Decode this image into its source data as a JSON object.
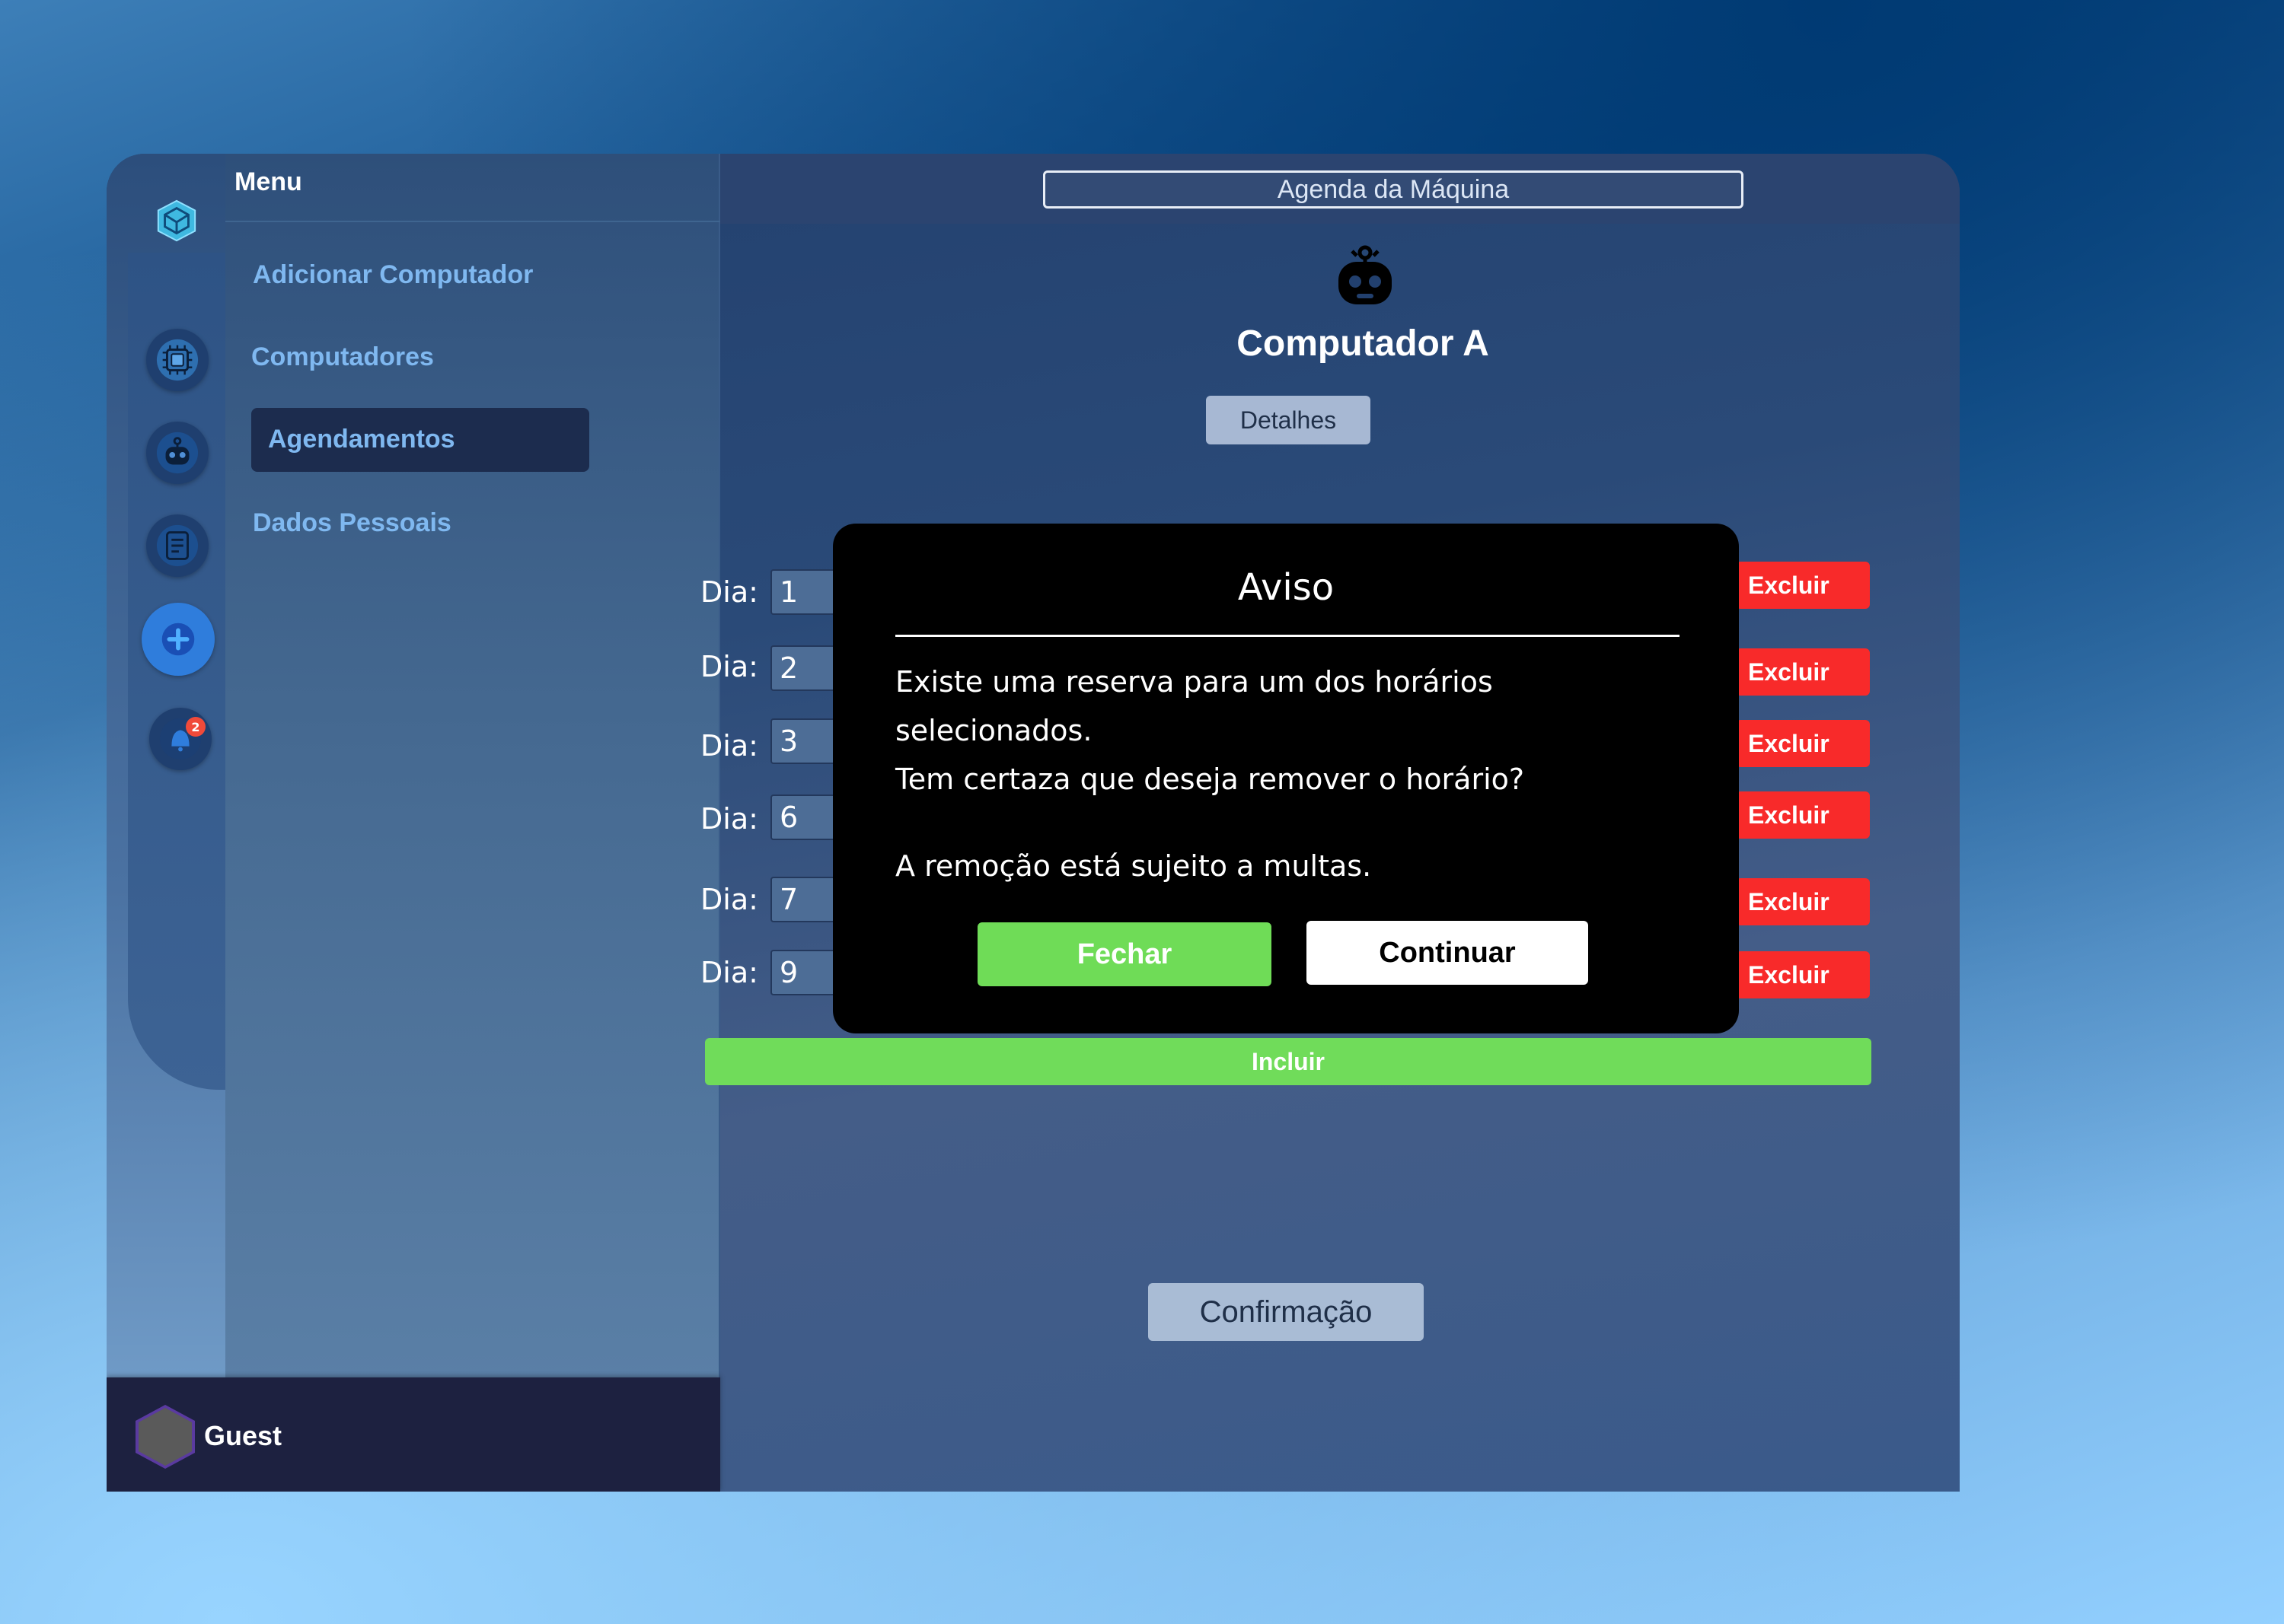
{
  "menu": {
    "title": "Menu",
    "items": [
      {
        "label": "Adicionar Computador"
      },
      {
        "label": "Computadores"
      },
      {
        "label": "Agendamentos",
        "active": true
      },
      {
        "label": "Dados Pessoais"
      }
    ]
  },
  "rail": {
    "icons": [
      "logo-icon",
      "computer-chip-icon",
      "robot-icon",
      "list-icon",
      "add-icon",
      "bell-icon"
    ],
    "notification_count": "2"
  },
  "user": {
    "name": "Guest"
  },
  "header": {
    "title": "Agenda da Máquina"
  },
  "machine": {
    "name": "Computador A",
    "details_label": "Detalhes"
  },
  "schedule": {
    "day_label": "Dia:",
    "rows": [
      {
        "day": "1",
        "delete_label": "Excluir"
      },
      {
        "day": "2",
        "delete_label": "Excluir"
      },
      {
        "day": "3",
        "delete_label": "Excluir"
      },
      {
        "day": "6",
        "delete_label": "Excluir"
      },
      {
        "day": "7",
        "delete_label": "Excluir"
      },
      {
        "day": "9",
        "delete_label": "Excluir"
      }
    ],
    "include_label": "Incluir",
    "confirm_label": "Confirmação"
  },
  "modal": {
    "title": "Aviso",
    "line1": "Existe uma reserva para um dos horários",
    "line2": "selecionados.",
    "line3": "Tem certaza que deseja remover o horário?",
    "line4": "A remoção está sujeito a multas.",
    "close_label": "Fechar",
    "continue_label": "Continuar"
  },
  "colors": {
    "accent_green": "#70dc5a",
    "danger_red": "#f82a2a",
    "menu_link": "#7fb8f0"
  }
}
